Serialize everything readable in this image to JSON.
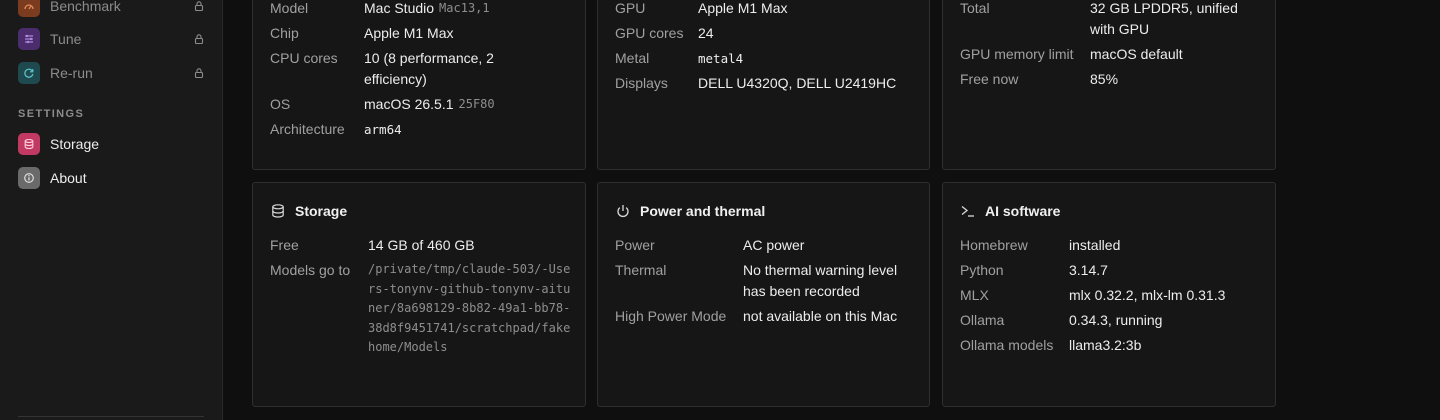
{
  "sidebar": {
    "items": [
      {
        "label": "Benchmark",
        "icon": "gauge-icon",
        "color": "#7a3b1f",
        "locked": true
      },
      {
        "label": "Tune",
        "icon": "sliders-icon",
        "color": "#4b2d6e",
        "locked": true
      },
      {
        "label": "Re-run",
        "icon": "refresh-icon",
        "color": "#1e4a4f",
        "locked": true
      }
    ],
    "settings_title": "SETTINGS",
    "settings_items": [
      {
        "label": "Storage",
        "icon": "database-icon",
        "color": "#c23a63"
      },
      {
        "label": "About",
        "icon": "info-icon",
        "color": "#6a6a6a"
      }
    ]
  },
  "machine": {
    "model_key": "Model",
    "model_val": "Mac Studio",
    "model_id": "Mac13,1",
    "chip_key": "Chip",
    "chip_val": "Apple M1 Max",
    "cpu_key": "CPU cores",
    "cpu_val_1": "10 (8 performance, 2",
    "cpu_val_2": "efficiency)",
    "os_key": "OS",
    "os_val": "macOS 26.5.1",
    "os_build": "25F80",
    "arch_key": "Architecture",
    "arch_val": "arm64"
  },
  "graphics": {
    "gpu_key": "GPU",
    "gpu_val": "Apple M1 Max",
    "cores_key": "GPU cores",
    "cores_val": "24",
    "metal_key": "Metal",
    "metal_val": "metal4",
    "displays_key": "Displays",
    "displays_val": "DELL U4320Q, DELL U2419HC"
  },
  "memory": {
    "total_key": "Total",
    "total_val_1": "32 GB LPDDR5, unified",
    "total_val_2": "with GPU",
    "limit_key": "GPU memory limit",
    "limit_val": "macOS default",
    "free_key": "Free now",
    "free_val": "85%"
  },
  "storage": {
    "title": "Storage",
    "free_key": "Free",
    "free_val": "14 GB of 460 GB",
    "models_key": "Models go to",
    "models_val": "/private/tmp/claude-503/-Users-tonynv-github-tonynv-aituner/8a698129-8b82-49a1-bb78-38d8f9451741/scratchpad/fakehome/Models"
  },
  "power": {
    "title": "Power and thermal",
    "power_key": "Power",
    "power_val": "AC power",
    "thermal_key": "Thermal",
    "thermal_val_1": "No thermal warning level",
    "thermal_val_2": "has been recorded",
    "hpm_key": "High Power Mode",
    "hpm_val": "not available on this Mac"
  },
  "ai": {
    "title": "AI software",
    "homebrew_key": "Homebrew",
    "homebrew_val": "installed",
    "python_key": "Python",
    "python_val": "3.14.7",
    "mlx_key": "MLX",
    "mlx_val": "mlx 0.32.2, mlx-lm 0.31.3",
    "ollama_key": "Ollama",
    "ollama_val": "0.34.3, running",
    "models_key": "Ollama models",
    "models_val": "llama3.2:3b"
  }
}
